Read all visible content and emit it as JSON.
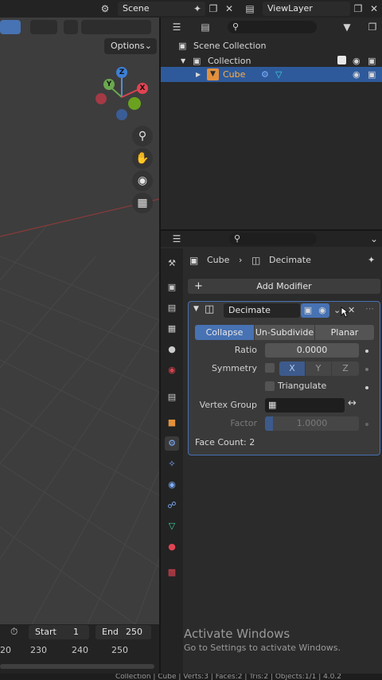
{
  "topbar": {
    "scene_label": "Scene",
    "viewlayer_label": "ViewLayer"
  },
  "viewport": {
    "options_label": "Options",
    "gizmo": {
      "z": "Z",
      "y": "Y",
      "x": "X"
    }
  },
  "outliner": {
    "rows": [
      {
        "label": "Scene Collection"
      },
      {
        "label": "Collection"
      },
      {
        "label": "Cube"
      }
    ]
  },
  "properties": {
    "breadcrumb": {
      "object": "Cube",
      "modifier": "Decimate"
    },
    "add_modifier_label": "Add Modifier",
    "modifier": {
      "name": "Decimate",
      "modes": [
        "Collapse",
        "Un-Subdivide",
        "Planar"
      ],
      "active_mode": "Collapse",
      "ratio_label": "Ratio",
      "ratio_value": "0.0000",
      "symmetry_label": "Symmetry",
      "axes": [
        "X",
        "Y",
        "Z"
      ],
      "active_axis": "X",
      "triangulate_label": "Triangulate",
      "vertex_group_label": "Vertex Group",
      "factor_label": "Factor",
      "factor_value": "1.0000",
      "face_count_label": "Face Count: 2"
    }
  },
  "timeline": {
    "start_label": "Start",
    "start_value": "1",
    "end_label": "End",
    "end_value": "250",
    "ticks": [
      "20",
      "230",
      "240",
      "250"
    ]
  },
  "watermark": {
    "title": "Activate Windows",
    "subtitle": "Go to Settings to activate Windows."
  },
  "statusbar": {
    "text": "Collection | Cube | Verts:3 | Faces:2 | Tris:2 | Objects:1/1 | 4.0.2"
  },
  "colors": {
    "accent": "#4772b3",
    "selection": "#2e5a9b",
    "viewport_bg": "#3d3d3d",
    "panel_bg": "#2b2b2b"
  }
}
